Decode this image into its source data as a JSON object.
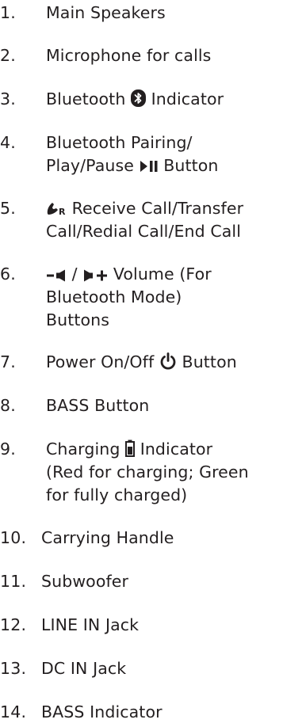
{
  "items": [
    {
      "num": "1.",
      "lines": [
        "Main Speakers"
      ]
    },
    {
      "num": "2.",
      "lines": [
        "Microphone for calls"
      ]
    },
    {
      "num": "3.",
      "pre": "Bluetooth ",
      "post": " Indicator",
      "icon": "bluetooth-icon"
    },
    {
      "num": "4.",
      "lines": [
        "Bluetooth Pairing/"
      ],
      "l2pre": "Play/Pause ",
      "l2post": " Button",
      "icon": "play-pause-icon"
    },
    {
      "num": "5.",
      "l1post": " Receive Call/Transfer",
      "lines2": "Call/Redial Call/End Call",
      "icon": "phone-r-icon"
    },
    {
      "num": "6.",
      "sep": " / ",
      "l1post": " Volume (For",
      "lines": [
        "Bluetooth Mode)",
        "Buttons"
      ],
      "icons": [
        "volume-down-icon",
        "volume-up-icon"
      ]
    },
    {
      "num": "7.",
      "pre": "Power On/Off ",
      "post": " Button",
      "icon": "power-icon"
    },
    {
      "num": "8.",
      "lines": [
        "BASS Button"
      ]
    },
    {
      "num": "9.",
      "pre": "Charging ",
      "post": " Indicator",
      "lines": [
        "(Red for charging; Green",
        "for fully charged)"
      ],
      "icon": "battery-icon"
    },
    {
      "num": "10.",
      "lines": [
        "Carrying Handle"
      ]
    },
    {
      "num": "11.",
      "lines": [
        "Subwoofer"
      ]
    },
    {
      "num": "12.",
      "lines": [
        "LINE IN Jack"
      ]
    },
    {
      "num": "13.",
      "lines": [
        "DC IN Jack"
      ]
    },
    {
      "num": "14.",
      "lines": [
        "BASS Indicator"
      ]
    }
  ]
}
